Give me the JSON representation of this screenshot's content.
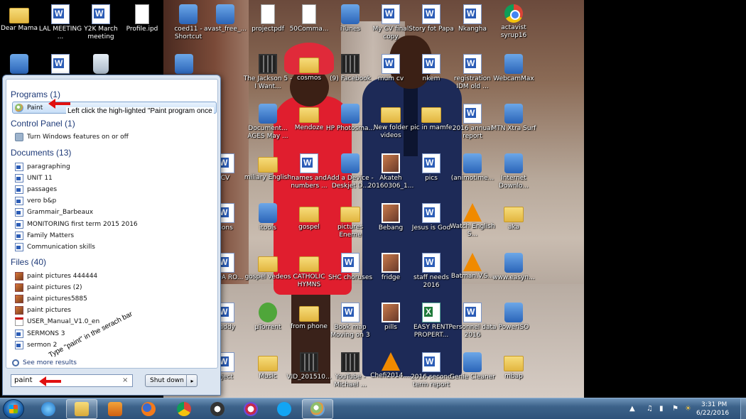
{
  "desktop": {
    "left_icons": [
      {
        "label": "Dear Mama",
        "kind": "folder"
      },
      {
        "label": "LAL MEETING ...",
        "kind": "word"
      },
      {
        "label": "Y2K March meeting",
        "kind": "word"
      },
      {
        "label": "Profile.ipd",
        "kind": "doc"
      }
    ],
    "icons": [
      {
        "label": "coed11 - Shortcut",
        "kind": "app"
      },
      {
        "label": "avast_free_...",
        "kind": "app"
      },
      {
        "label": "projectpdf",
        "kind": "doc"
      },
      {
        "label": "50Comma...",
        "kind": "doc"
      },
      {
        "label": "iTunes",
        "kind": "app"
      },
      {
        "label": "My CV final copy",
        "kind": "word"
      },
      {
        "label": "Story fot Papa",
        "kind": "word"
      },
      {
        "label": "Nkangha",
        "kind": "word"
      },
      {
        "label": "actavist syrup16",
        "kind": "chrome"
      },
      {
        "label": "The Jackson 5 - I Want...",
        "kind": "film"
      },
      {
        "label": "cosmos",
        "kind": "folder"
      },
      {
        "label": "(9) Facebook",
        "kind": "film"
      },
      {
        "label": "mum cv",
        "kind": "word"
      },
      {
        "label": "nkem",
        "kind": "word"
      },
      {
        "label": "registration IDM old ...",
        "kind": "word"
      },
      {
        "label": "WebcamMax",
        "kind": "app"
      },
      {
        "label": "Document... AGES May ...",
        "kind": "app"
      },
      {
        "label": "Mendoze",
        "kind": "folder"
      },
      {
        "label": "HP Photosma...",
        "kind": "app"
      },
      {
        "label": "New folder videos",
        "kind": "folder"
      },
      {
        "label": "pic in mamfe",
        "kind": "folder"
      },
      {
        "label": "2016 annual report",
        "kind": "word"
      },
      {
        "label": "MTN Xtra Surf",
        "kind": "app"
      },
      {
        "label": "CV",
        "kind": "word"
      },
      {
        "label": "miliary English",
        "kind": "folder"
      },
      {
        "label": "names and numbers ...",
        "kind": "word"
      },
      {
        "label": "Add a Device - Deskjet D...",
        "kind": "app"
      },
      {
        "label": "Akateh 20160306_1...",
        "kind": "photo"
      },
      {
        "label": "pics",
        "kind": "word"
      },
      {
        "label": "(animotime...",
        "kind": "app"
      },
      {
        "label": "Internet Downlo...",
        "kind": "app"
      },
      {
        "label": "nons",
        "kind": "word"
      },
      {
        "label": "itools",
        "kind": "app"
      },
      {
        "label": "gospel",
        "kind": "folder"
      },
      {
        "label": "pictures Eneme",
        "kind": "folder"
      },
      {
        "label": "Bebang",
        "kind": "photo"
      },
      {
        "label": "Jesus is God",
        "kind": "word"
      },
      {
        "label": "Watch English S...",
        "kind": "vlc"
      },
      {
        "label": "aka",
        "kind": "folder"
      },
      {
        "label": "MEDA RO...",
        "kind": "word"
      },
      {
        "label": "gospel vedeos",
        "kind": "folder"
      },
      {
        "label": "CATHOLIC HYMNS",
        "kind": "folder"
      },
      {
        "label": "SHC choruses",
        "kind": "word"
      },
      {
        "label": "fridge",
        "kind": "photo"
      },
      {
        "label": "staff needs 2016",
        "kind": "word"
      },
      {
        "label": "Batman.V.S...",
        "kind": "vlc"
      },
      {
        "label": "www.easyn...",
        "kind": "app"
      },
      {
        "label": "daddy",
        "kind": "word"
      },
      {
        "label": "µTorrent",
        "kind": "torrent"
      },
      {
        "label": "from phone",
        "kind": "folder"
      },
      {
        "label": "Book map Moving on 3",
        "kind": "word"
      },
      {
        "label": "pills",
        "kind": "photo"
      },
      {
        "label": "EASY RENT PROPERT...",
        "kind": "excel"
      },
      {
        "label": "Personnel data 2016",
        "kind": "word"
      },
      {
        "label": "PowerISO",
        "kind": "app"
      },
      {
        "label": "oject",
        "kind": "word"
      },
      {
        "label": "Music",
        "kind": "folder"
      },
      {
        "label": "VID_201510...",
        "kind": "film"
      },
      {
        "label": "YouTube - Michael ...",
        "kind": "film"
      },
      {
        "label": "Chefi2014....",
        "kind": "vlc"
      },
      {
        "label": "2016 second term report",
        "kind": "word"
      },
      {
        "label": "Genie Cleaner",
        "kind": "app"
      },
      {
        "label": "mbap",
        "kind": "folder"
      }
    ]
  },
  "start_menu": {
    "groups": {
      "programs": {
        "title": "Programs (1)",
        "items": [
          "Paint"
        ]
      },
      "control_panel": {
        "title": "Control Panel (1)",
        "items": [
          "Turn Windows features on or off"
        ]
      },
      "documents": {
        "title": "Documents (13)",
        "items": [
          "paragraphing",
          "UNIT 11",
          "passages",
          "vero b&p",
          "Grammair_Barbeaux",
          "MONITORING first term 2015 2016",
          "Family Matters",
          "Communication skills"
        ]
      },
      "files": {
        "title": "Files (40)",
        "items": [
          {
            "label": "paint pictures 444444",
            "kind": "img"
          },
          {
            "label": "paint pictures (2)",
            "kind": "img"
          },
          {
            "label": "paint pictures5885",
            "kind": "img"
          },
          {
            "label": "paint pictures",
            "kind": "img"
          },
          {
            "label": "USER_Manual_V1.0_en",
            "kind": "pdf"
          },
          {
            "label": "SERMONS 3",
            "kind": "word"
          },
          {
            "label": "sermon 2",
            "kind": "word"
          }
        ]
      }
    },
    "see_more": "See more results",
    "search": {
      "value": "paint",
      "clear": "×"
    },
    "shutdown_label": "Shut down",
    "shutdown_arrow": "▸"
  },
  "annotations": {
    "paint": "Left click the high-lighted \"Paint program once",
    "search": "Type \"paint\" in the serach bar",
    "arrow_color": "#e01010"
  },
  "taskbar": {
    "pinned": [
      "internet-explorer",
      "windows-explorer",
      "media-player",
      "firefox",
      "chrome",
      "messenger",
      "opera",
      "skype",
      "paint"
    ],
    "active": [
      "windows-explorer",
      "paint"
    ],
    "tray_icons": [
      "chevron-up",
      "volume",
      "network",
      "flag",
      "brightness"
    ],
    "time": "3:31 PM",
    "date": "6/22/2016"
  }
}
